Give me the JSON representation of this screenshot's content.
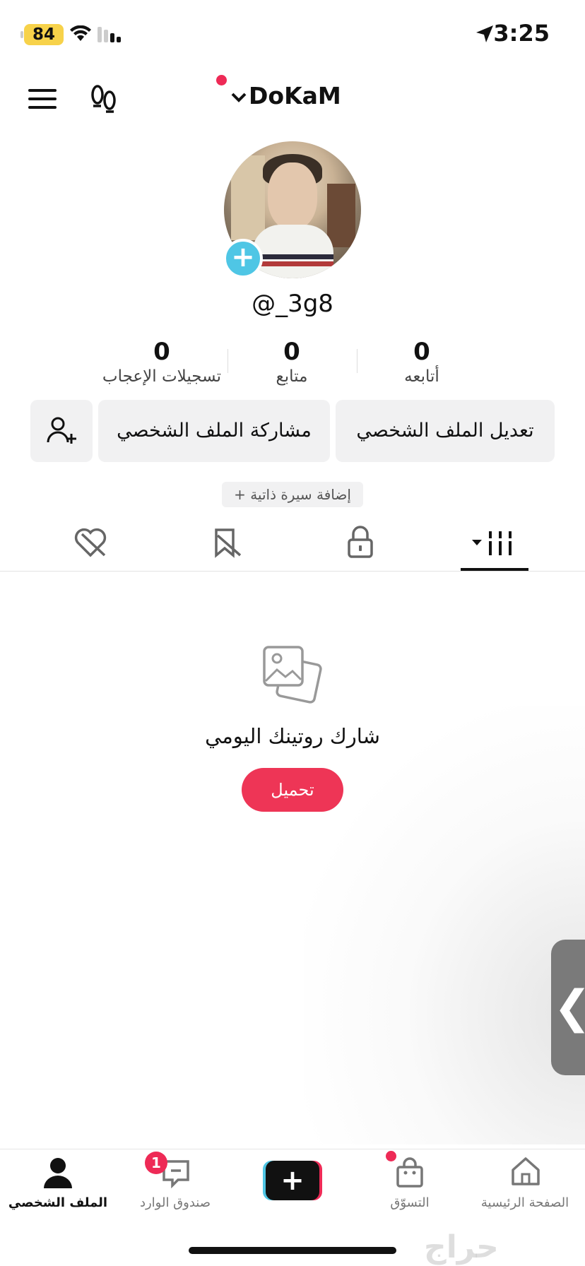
{
  "status_bar": {
    "battery": "84",
    "time": "3:25"
  },
  "header": {
    "username": "DoKaM"
  },
  "profile": {
    "handle": "@_3g8",
    "stats": [
      {
        "value": "0",
        "label": "أتابعه"
      },
      {
        "value": "0",
        "label": "متابع"
      },
      {
        "value": "0",
        "label": "تسجيلات الإعجاب"
      }
    ],
    "edit_profile": "تعديل الملف الشخصي",
    "share_profile": "مشاركة الملف الشخصي",
    "add_bio": "+ إضافة سيرة ذاتية"
  },
  "empty_state": {
    "title": "شارك روتينك اليومي",
    "upload": "تحميل"
  },
  "side_tab_glyph": "❮",
  "bottom_nav": {
    "home": "الصفحة الرئيسية",
    "shop": "التسوّق",
    "create": "+",
    "inbox": "صندوق الوارد",
    "inbox_badge": "1",
    "profile": "الملف الشخصي"
  },
  "watermark": "حراج",
  "colors": {
    "accent": "#ee3556",
    "plus": "#4fc6e5",
    "battery": "#f7d24a"
  }
}
